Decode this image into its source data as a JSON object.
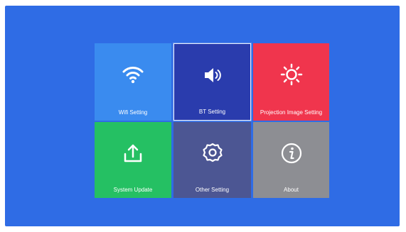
{
  "tiles": [
    {
      "label": "Wifi Setting",
      "icon": "wifi-icon",
      "color": "#3a8bef"
    },
    {
      "label": "BT Setting",
      "icon": "speaker-icon",
      "color": "#2a3cad",
      "selected": true
    },
    {
      "label": "Projection Image Setting",
      "icon": "sun-icon",
      "color": "#f0354d"
    },
    {
      "label": "System Update",
      "icon": "upload-icon",
      "color": "#25c063"
    },
    {
      "label": "Other Setting",
      "icon": "gear-icon",
      "color": "#4c5693"
    },
    {
      "label": "About",
      "icon": "info-icon",
      "color": "#8d8e93"
    }
  ],
  "colors": {
    "background": "#2f6ce5",
    "selected_border": "#e8eefc"
  }
}
